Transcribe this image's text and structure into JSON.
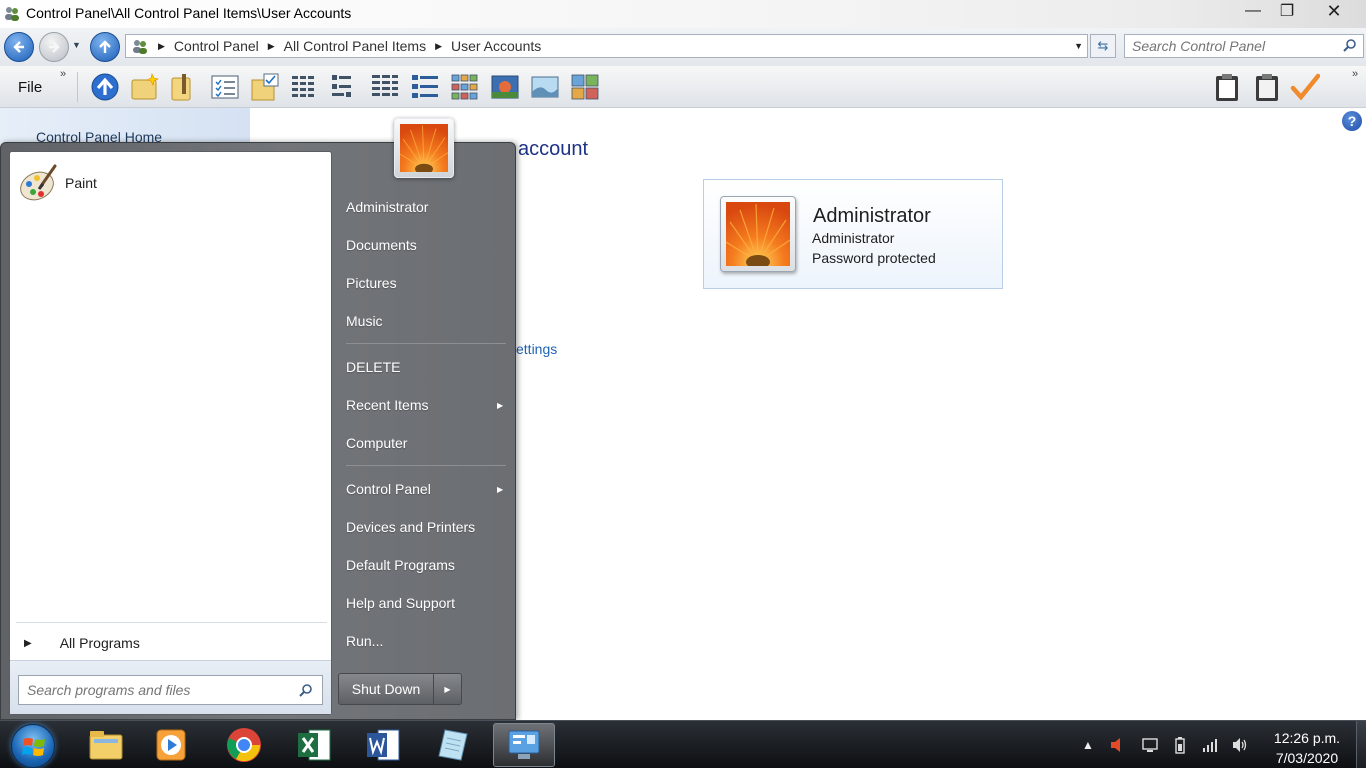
{
  "window": {
    "title": "Control Panel\\All Control Panel Items\\User Accounts",
    "minimize_glyph": "—",
    "maximize_glyph": "❐",
    "close_glyph": "✕"
  },
  "navigation": {
    "breadcrumbs": [
      "Control Panel",
      "All Control Panel Items",
      "User Accounts"
    ],
    "search_placeholder": "Search Control Panel",
    "refresh_glyph": "⇆"
  },
  "toolbar": {
    "file_label": "File",
    "icons": [
      "up-folder-icon",
      "new-folder-icon",
      "properties-icon",
      "checklist-icon",
      "folder-check-icon",
      "details-view-icon",
      "list-view-icon",
      "small-icons-view-icon",
      "tiles-view-icon",
      "medium-icons-view-icon",
      "large-icons-view-icon",
      "picture-view-icon",
      "extra-large-icons-view-icon",
      "clipboard-icon",
      "clipboard-paste-icon",
      "checkmark-icon"
    ]
  },
  "left_pane": {
    "home_link": "Control Panel Home"
  },
  "main": {
    "heading_fragment": "account",
    "settings_fragment": "ettings",
    "help_glyph": "?",
    "account": {
      "name": "Administrator",
      "type": "Administrator",
      "status": "Password protected"
    }
  },
  "start_menu": {
    "pinned": [
      {
        "label": "Paint",
        "icon": "paint-palette-icon"
      }
    ],
    "all_programs": "All Programs",
    "search_placeholder": "Search programs and files",
    "right_links": [
      {
        "label": "Administrator",
        "submenu": false
      },
      {
        "label": "Documents",
        "submenu": false
      },
      {
        "label": "Pictures",
        "submenu": false
      },
      {
        "label": "Music",
        "submenu": false
      },
      {
        "label": "DELETE",
        "submenu": false
      },
      {
        "label": "Recent Items",
        "submenu": true
      },
      {
        "label": "Computer",
        "submenu": false
      },
      {
        "label": "Control Panel",
        "submenu": true
      },
      {
        "label": "Devices and Printers",
        "submenu": false
      },
      {
        "label": "Default Programs",
        "submenu": false
      },
      {
        "label": "Help and Support",
        "submenu": false
      },
      {
        "label": "Run...",
        "submenu": false
      }
    ],
    "shutdown_label": "Shut Down"
  },
  "taskbar": {
    "apps": [
      "windows-explorer-icon",
      "media-player-icon",
      "chrome-icon",
      "excel-icon",
      "word-icon",
      "notepad-icon",
      "control-panel-icon"
    ],
    "active_app": "control-panel-icon",
    "tray": [
      "show-hidden-icons-icon",
      "speaker-muted-icon",
      "action-center-icon",
      "battery-icon",
      "network-signal-icon",
      "volume-icon"
    ],
    "time": "12:26 p.m.",
    "date": "7/03/2020"
  },
  "colors": {
    "link_blue": "#1e62b3",
    "heading_blue": "#1e3287",
    "start_menu_gray": "#6b6e72",
    "taskbar_dark": "#0d0f12"
  }
}
